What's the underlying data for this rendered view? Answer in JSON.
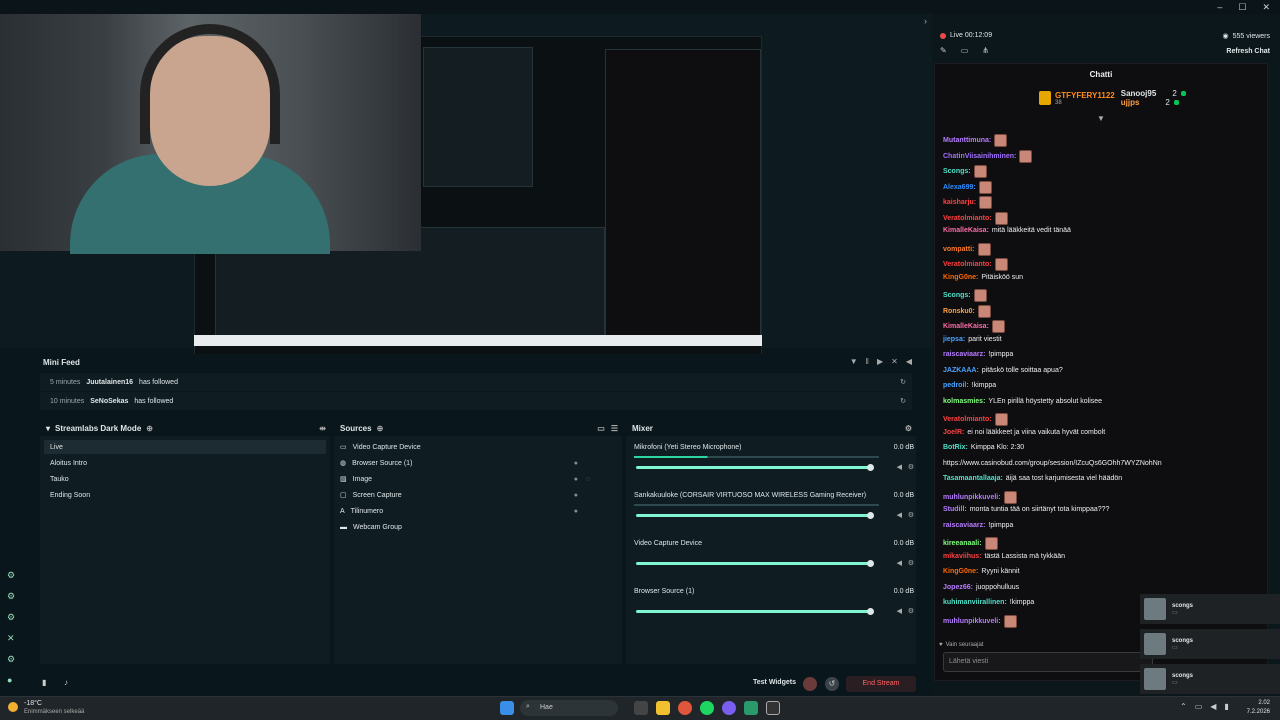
{
  "live": {
    "label": "Live",
    "time": "00:12:09",
    "viewers": "555 viewers",
    "refresh": "Refresh Chat"
  },
  "chat": {
    "title": "Chatti",
    "top_subs": [
      {
        "name": "GTFYFERY1122",
        "count": "38",
        "color": "#ff8c1a"
      },
      {
        "name": "Sanooj95",
        "count": "2",
        "color": "#ffffff"
      },
      {
        "name": "ujjps",
        "count": "2",
        "color": "#ff9f43"
      }
    ],
    "messages": [
      {
        "user": "Mutanttimuna:",
        "text": "",
        "color": "#b57cff",
        "emote": true
      },
      {
        "user": "ChatinViisainihminen:",
        "text": "",
        "color": "#a070ff",
        "emote": true
      },
      {
        "user": "Scongs:",
        "text": "",
        "color": "#4fe0c8",
        "emote": true
      },
      {
        "user": "Alexa699:",
        "text": "",
        "color": "#2e8cff",
        "emote": true
      },
      {
        "user": "kaisharju:",
        "text": "",
        "color": "#ff4040",
        "emote": true
      },
      {
        "user": "Veratolmianto:",
        "text": "",
        "color": "#ff4040",
        "emote": true
      },
      {
        "user": "KimalleKaisa:",
        "text": "mitä lääkkeitä vedit tänää",
        "color": "#ff6ba8",
        "emote": false
      },
      {
        "user": "vompatti:",
        "text": "",
        "color": "#ff7a2a",
        "emote": true
      },
      {
        "user": "Veratolmianto:",
        "text": "",
        "color": "#ff4040",
        "emote": true
      },
      {
        "user": "KingG0ne:",
        "text": "Pitäisköö sun",
        "color": "#ff6a00",
        "emote": false
      },
      {
        "user": "Scongs:",
        "text": "",
        "color": "#4fe0c8",
        "emote": true
      },
      {
        "user": "Ronsku0:",
        "text": "",
        "color": "#ff9f43",
        "emote": true
      },
      {
        "user": "KimalleKaisa:",
        "text": "",
        "color": "#ff6ba8",
        "emote": true
      },
      {
        "user": "jiepsa:",
        "text": "parit viestit",
        "color": "#4aa3ff",
        "emote": false
      },
      {
        "user": "raiscaviaarz:",
        "text": "!pimppa",
        "color": "#b57cff",
        "emote": false
      },
      {
        "user": "JAZKAAA:",
        "text": "pitäskö tolle soittaa apua?",
        "color": "#4aa3ff",
        "emote": false
      },
      {
        "user": "pedroil:",
        "text": "!kimppa",
        "color": "#4aa3ff",
        "emote": false
      },
      {
        "user": "kolmasmies:",
        "text": "YLEn pirillä höystetty absolut kolisee",
        "color": "#80ff80",
        "emote": false
      },
      {
        "user": "Veratolmianto:",
        "text": "",
        "color": "#ff4040",
        "emote": true
      },
      {
        "user": "JoelR:",
        "text": "ei noi lääkkeet ja viina vaikuta hyvät combolt",
        "color": "#ff4040",
        "emote": false
      },
      {
        "user": "BotRix:",
        "text": "Kimppa Klo: 2:30",
        "color": "#4fe0c8",
        "emote": false
      },
      {
        "user": "",
        "text": "https://www.casinobud.com/group/session/IZcuQs6GOhh7WYZNohNn",
        "color": "#ffffff",
        "emote": false
      },
      {
        "user": "Tasamaantallaaja:",
        "text": "äijä saa tost karjumisesta viel häädön",
        "color": "#4fe0c8",
        "emote": false
      },
      {
        "user": "muhlunpikkuveli:",
        "text": "",
        "color": "#b57cff",
        "emote": true
      },
      {
        "user": "Studill:",
        "text": "monta tuntia tää on siirtänyt tota kimppaa???",
        "color": "#b57cff",
        "emote": false
      },
      {
        "user": "raiscaviaarz:",
        "text": "!pimppa",
        "color": "#b57cff",
        "emote": false
      },
      {
        "user": "kireeanaali:",
        "text": "",
        "color": "#80ff80",
        "emote": true
      },
      {
        "user": "mikaviihus:",
        "text": "tästä Lassista mä tykkään",
        "color": "#ff4040",
        "emote": false
      },
      {
        "user": "KingG0ne:",
        "text": "Ryyni kännit",
        "color": "#ff6a00",
        "emote": false
      },
      {
        "user": "Jopez66:",
        "text": "juoppohulluus",
        "color": "#b57cff",
        "emote": false
      },
      {
        "user": "kuhimanviirallinen:",
        "text": "!kimppa",
        "color": "#4fe0c8",
        "emote": false
      },
      {
        "user": "muhlunpikkuveli:",
        "text": "",
        "color": "#b57cff",
        "emote": true
      }
    ],
    "followers_only": "Vain seuraajat",
    "input_placeholder": "Lähetä viesti"
  },
  "minifeed": {
    "title": "Mini Feed",
    "rows": [
      {
        "time": "5 minutes",
        "user": "Juutalainen16",
        "action": "has followed"
      },
      {
        "time": "10 minutes",
        "user": "SeNoSekas",
        "action": "has followed"
      }
    ]
  },
  "scenes": {
    "title": "Streamlabs Dark Mode",
    "items": [
      "Live",
      "Aloitus Intro",
      "Tauko",
      "Ending Soon"
    ]
  },
  "sources": {
    "title": "Sources",
    "items": [
      "Video Capture Device",
      "Browser Source (1)",
      "Image",
      "Screen Capture",
      "Tilinumero",
      "Webcam Group"
    ]
  },
  "mixer": {
    "title": "Mixer",
    "channels": [
      {
        "name": "Mikrofoni (Yeti Stereo Microphone)",
        "db": "0.0 dB"
      },
      {
        "name": "Sankakuuloke (CORSAIR VIRTUOSO MAX WIRELESS Gaming Receiver)",
        "db": "0.0 dB"
      },
      {
        "name": "Video Capture Device",
        "db": "0.0 dB"
      },
      {
        "name": "Browser Source (1)",
        "db": "0.0 dB"
      }
    ]
  },
  "footer": {
    "test_widgets": "Test Widgets",
    "end_stream": "End Stream"
  },
  "notifications": [
    {
      "name": "scongs"
    },
    {
      "name": "scongs"
    },
    {
      "name": "scongs"
    }
  ],
  "taskbar": {
    "weather_temp": "-18°C",
    "weather_desc": "Enimmäkseen selkeää",
    "search": "Hae",
    "time": "2.02",
    "date": "7.2.2026"
  }
}
